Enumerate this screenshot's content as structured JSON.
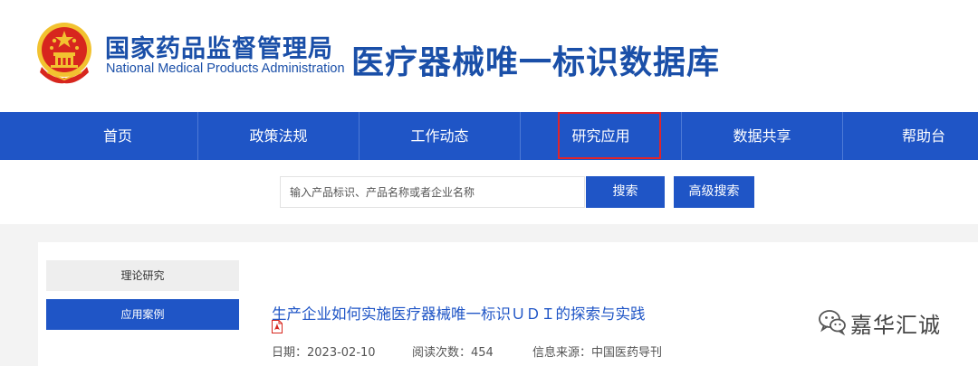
{
  "header": {
    "org_name_cn": "国家药品监督管理局",
    "org_name_en": "National Medical Products  Administration",
    "site_title": "医疗器械唯一标识数据库"
  },
  "nav": {
    "items": [
      {
        "label": "首页"
      },
      {
        "label": "政策法规"
      },
      {
        "label": "工作动态"
      },
      {
        "label": "研究应用",
        "highlighted": true
      },
      {
        "label": "数据共享"
      },
      {
        "label": "帮助台"
      }
    ],
    "highlight_color": "#e0242a"
  },
  "search": {
    "placeholder": "输入产品标识、产品名称或者企业名称",
    "search_label": "搜索",
    "advanced_label": "高级搜索"
  },
  "sidebar": {
    "items": [
      {
        "label": "理论研究",
        "active": false
      },
      {
        "label": "应用案例",
        "active": true
      }
    ]
  },
  "article": {
    "title": "生产企业如何实施医疗器械唯一标识ＵＤＩ的探索与实践",
    "attachment_icon": "pdf-icon",
    "date_label": "日期：2023-02-10",
    "views_label": "阅读次数：454",
    "source_label": "信息来源：中国医药导刊"
  },
  "watermark": {
    "icon": "wechat-icon",
    "text": "嘉华汇诚"
  },
  "colors": {
    "primary": "#1f55c6",
    "title_blue": "#1a4fa8",
    "emblem_red": "#d7261e",
    "emblem_gold": "#f2c230"
  }
}
